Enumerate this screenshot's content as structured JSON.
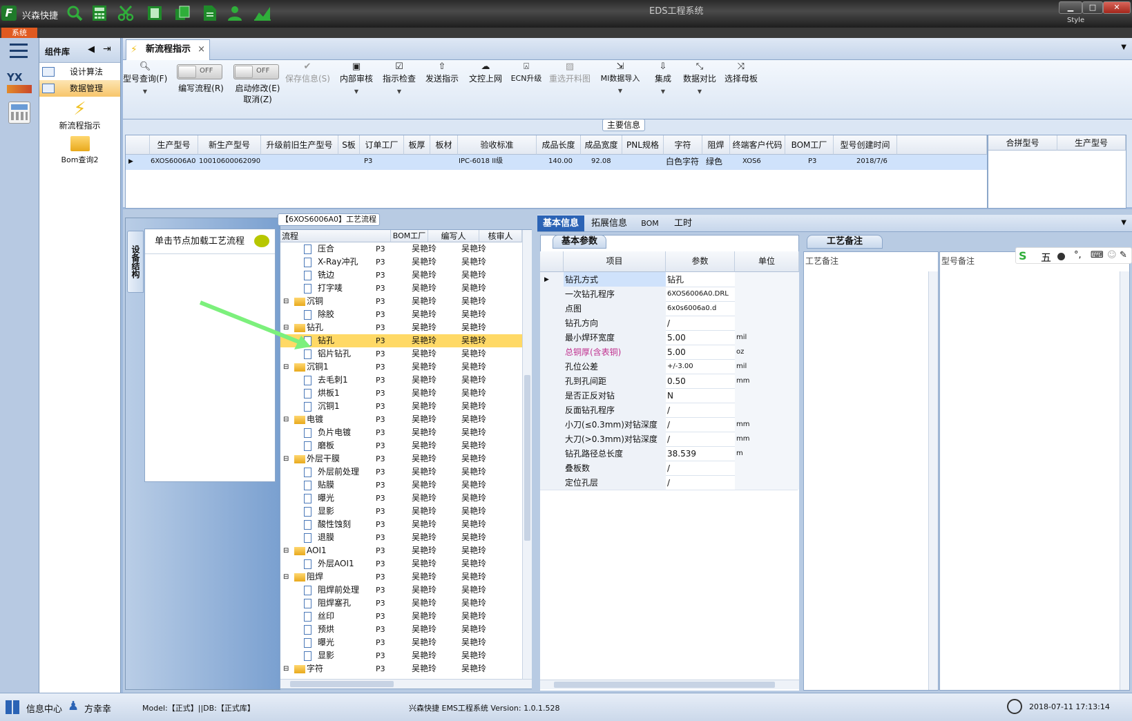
{
  "app": {
    "name": "兴森快捷",
    "window_title": "EDS工程系统",
    "style_label": "Style",
    "menu_system": "系统"
  },
  "left_library": {
    "title": "组件库",
    "items": [
      {
        "label": "设计算法"
      },
      {
        "label": "数据管理"
      }
    ],
    "big_items": [
      {
        "label": "新流程指示"
      },
      {
        "label": "Bom查询2"
      }
    ],
    "yx_label": "YX"
  },
  "doc_tab": {
    "label": "新流程指示",
    "close": "×"
  },
  "ribbon": {
    "buttons": [
      {
        "label": "型号查询(F)",
        "icon": "search-icon",
        "dropdown": true
      },
      {
        "label": "保存信息(S)",
        "icon": "check-icon",
        "disabled": true
      },
      {
        "label": "内部审核",
        "icon": "printer-icon",
        "dropdown": true
      },
      {
        "label": "指示检查",
        "icon": "checkbox-icon",
        "dropdown": true
      },
      {
        "label": "发送指示",
        "icon": "upload-icon"
      },
      {
        "label": "文控上网",
        "icon": "cloud-upload-icon"
      },
      {
        "label": "ECN升级",
        "icon": "ecn-icon"
      },
      {
        "label": "重选开料图",
        "icon": "image-icon",
        "disabled": true
      },
      {
        "label": "MI数据导入",
        "icon": "import-icon",
        "dropdown": true
      },
      {
        "label": "集成",
        "icon": "download-icon",
        "dropdown": true
      },
      {
        "label": "数据对比",
        "icon": "compare-icon",
        "dropdown": true
      },
      {
        "label": "选择母板",
        "icon": "shuffle-icon"
      }
    ],
    "toggles": [
      {
        "label": "编写流程(R)",
        "state": "OFF"
      },
      {
        "label": "启动修改(E)",
        "sub": "取消(Z)",
        "state": "OFF"
      }
    ]
  },
  "main_info": {
    "title": "主要信息",
    "columns": [
      "生产型号",
      "新生产型号",
      "升级前旧生产型号",
      "S板",
      "订单工厂",
      "板厚",
      "板材",
      "验收标准",
      "成品长度",
      "成品宽度",
      "PNL规格",
      "字符",
      "阻焊",
      "终端客户代码",
      "BOM工厂",
      "型号创建时间"
    ],
    "rows": [
      [
        "6XOS6006A0",
        "10010600062090",
        "",
        "",
        "P3",
        "",
        "",
        "IPC-6018 II级",
        "140.00",
        "92.08",
        "",
        "白色字符",
        "绿色",
        "XOS6",
        "P3",
        "2018/7/6"
      ]
    ],
    "side_columns": [
      "合拼型号",
      "生产型号"
    ]
  },
  "tree_panel": {
    "side_tab": "设备结构",
    "click_hint": "单击节点加载工艺流程"
  },
  "process": {
    "title": "【6XOS6006A0】工艺流程",
    "columns": [
      "流程",
      "BOM工厂",
      "编写人",
      "核审人"
    ],
    "rows": [
      {
        "name": "压合",
        "level": 2,
        "factory": "P3",
        "writer": "吴艳玲",
        "checker": "吴艳玲"
      },
      {
        "name": "X-Ray冲孔",
        "level": 2,
        "factory": "P3",
        "writer": "吴艳玲",
        "checker": "吴艳玲"
      },
      {
        "name": "铣边",
        "level": 2,
        "factory": "P3",
        "writer": "吴艳玲",
        "checker": "吴艳玲"
      },
      {
        "name": "打字唛",
        "level": 2,
        "factory": "P3",
        "writer": "吴艳玲",
        "checker": "吴艳玲"
      },
      {
        "name": "沉铜",
        "level": 1,
        "factory": "P3",
        "writer": "吴艳玲",
        "checker": "吴艳玲"
      },
      {
        "name": "除胶",
        "level": 2,
        "factory": "P3",
        "writer": "吴艳玲",
        "checker": "吴艳玲"
      },
      {
        "name": "钻孔",
        "level": 1,
        "factory": "P3",
        "writer": "吴艳玲",
        "checker": "吴艳玲"
      },
      {
        "name": "钻孔",
        "level": 2,
        "factory": "P3",
        "writer": "吴艳玲",
        "checker": "吴艳玲",
        "selected": true
      },
      {
        "name": "铝片钻孔",
        "level": 2,
        "factory": "P3",
        "writer": "吴艳玲",
        "checker": "吴艳玲"
      },
      {
        "name": "沉铜1",
        "level": 1,
        "factory": "P3",
        "writer": "吴艳玲",
        "checker": "吴艳玲"
      },
      {
        "name": "去毛刺1",
        "level": 2,
        "factory": "P3",
        "writer": "吴艳玲",
        "checker": "吴艳玲"
      },
      {
        "name": "烘板1",
        "level": 2,
        "factory": "P3",
        "writer": "吴艳玲",
        "checker": "吴艳玲"
      },
      {
        "name": "沉铜1",
        "level": 2,
        "factory": "P3",
        "writer": "吴艳玲",
        "checker": "吴艳玲"
      },
      {
        "name": "电镀",
        "level": 1,
        "factory": "P3",
        "writer": "吴艳玲",
        "checker": "吴艳玲"
      },
      {
        "name": "负片电镀",
        "level": 2,
        "factory": "P3",
        "writer": "吴艳玲",
        "checker": "吴艳玲"
      },
      {
        "name": "磨板",
        "level": 2,
        "factory": "P3",
        "writer": "吴艳玲",
        "checker": "吴艳玲"
      },
      {
        "name": "外层干膜",
        "level": 1,
        "factory": "P3",
        "writer": "吴艳玲",
        "checker": "吴艳玲"
      },
      {
        "name": "外层前处理",
        "level": 2,
        "factory": "P3",
        "writer": "吴艳玲",
        "checker": "吴艳玲"
      },
      {
        "name": "贴膜",
        "level": 2,
        "factory": "P3",
        "writer": "吴艳玲",
        "checker": "吴艳玲"
      },
      {
        "name": "曝光",
        "level": 2,
        "factory": "P3",
        "writer": "吴艳玲",
        "checker": "吴艳玲"
      },
      {
        "name": "显影",
        "level": 2,
        "factory": "P3",
        "writer": "吴艳玲",
        "checker": "吴艳玲"
      },
      {
        "name": "酸性蚀刻",
        "level": 2,
        "factory": "P3",
        "writer": "吴艳玲",
        "checker": "吴艳玲"
      },
      {
        "name": "退膜",
        "level": 2,
        "factory": "P3",
        "writer": "吴艳玲",
        "checker": "吴艳玲"
      },
      {
        "name": "AOI1",
        "level": 1,
        "factory": "P3",
        "writer": "吴艳玲",
        "checker": "吴艳玲"
      },
      {
        "name": "外层AOI1",
        "level": 2,
        "factory": "P3",
        "writer": "吴艳玲",
        "checker": "吴艳玲"
      },
      {
        "name": "阻焊",
        "level": 1,
        "factory": "P3",
        "writer": "吴艳玲",
        "checker": "吴艳玲"
      },
      {
        "name": "阻焊前处理",
        "level": 2,
        "factory": "P3",
        "writer": "吴艳玲",
        "checker": "吴艳玲"
      },
      {
        "name": "阻焊塞孔",
        "level": 2,
        "factory": "P3",
        "writer": "吴艳玲",
        "checker": "吴艳玲"
      },
      {
        "name": "丝印",
        "level": 2,
        "factory": "P3",
        "writer": "吴艳玲",
        "checker": "吴艳玲"
      },
      {
        "name": "预烘",
        "level": 2,
        "factory": "P3",
        "writer": "吴艳玲",
        "checker": "吴艳玲"
      },
      {
        "name": "曝光",
        "level": 2,
        "factory": "P3",
        "writer": "吴艳玲",
        "checker": "吴艳玲"
      },
      {
        "name": "显影",
        "level": 2,
        "factory": "P3",
        "writer": "吴艳玲",
        "checker": "吴艳玲"
      },
      {
        "name": "字符",
        "level": 1,
        "factory": "P3",
        "writer": "吴艳玲",
        "checker": "吴艳玲"
      }
    ]
  },
  "detail": {
    "tabs": [
      "基本信息",
      "拓展信息",
      "BOM",
      "工时"
    ],
    "section": "基本参数",
    "columns": [
      "项目",
      "参数",
      "单位"
    ],
    "rows": [
      {
        "item": "钻孔方式",
        "value": "钻孔",
        "unit": ""
      },
      {
        "item": "一次钻孔程序",
        "value": "6XOS6006A0.DRL",
        "unit": ""
      },
      {
        "item": "点图",
        "value": "6x0s6006a0.d",
        "unit": ""
      },
      {
        "item": "钻孔方向",
        "value": "/",
        "unit": ""
      },
      {
        "item": "最小焊环宽度",
        "value": "5.00",
        "unit": "mil"
      },
      {
        "item": "总铜厚(含表铜)",
        "value": "5.00",
        "unit": "oz",
        "highlight": true
      },
      {
        "item": "孔位公差",
        "value": "+/-3.00",
        "unit": "mil"
      },
      {
        "item": "孔到孔间距",
        "value": "0.50",
        "unit": "mm"
      },
      {
        "item": "是否正反对钻",
        "value": "N",
        "unit": ""
      },
      {
        "item": "反面钻孔程序",
        "value": "/",
        "unit": ""
      },
      {
        "item": "小刀(≤0.3mm)对钻深度",
        "value": "/",
        "unit": "mm"
      },
      {
        "item": "大刀(>0.3mm)对钻深度",
        "value": "/",
        "unit": "mm"
      },
      {
        "item": "钻孔路径总长度",
        "value": "38.539",
        "unit": "m"
      },
      {
        "item": "叠板数",
        "value": "/",
        "unit": ""
      },
      {
        "item": "定位孔层",
        "value": "/",
        "unit": ""
      }
    ]
  },
  "notes": {
    "section": "工艺备注",
    "columns": [
      "工艺备注",
      "型号备注"
    ]
  },
  "ime": {
    "label": "五"
  },
  "status": {
    "info_center": "信息中心",
    "user": "方幸幸",
    "model": "Model:【正式】||DB:【正式库】",
    "version": "兴森快捷 EMS工程系统 Version: 1.0.1.528",
    "datetime": "2018-07-11 17:13:14"
  },
  "colors": {
    "accent": "#2b63b5",
    "selected_row": "#ffd966",
    "highlight_text": "#c0308e",
    "arrow": "#7cf07c"
  }
}
